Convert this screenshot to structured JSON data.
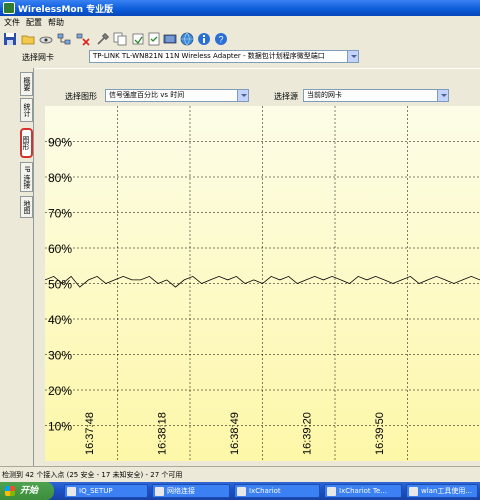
{
  "window": {
    "title": "WirelessMon 专业版"
  },
  "menu": [
    "文件",
    "配置",
    "帮助"
  ],
  "toolbar_icons": [
    "save-icon",
    "open-folder-icon",
    "view-icon",
    "network-icon",
    "disconnect-icon",
    "tools-icon",
    "copy-icon",
    "export-icon",
    "clipboard-check-icon",
    "adapter-icon",
    "globe-icon",
    "info-icon",
    "help-icon"
  ],
  "adapter": {
    "label": "选择网卡",
    "value": "TP-LINK TL-WN821N 11N Wireless Adapter - 数据包计划程序微型端口"
  },
  "tabs": [
    "概要",
    "统计",
    "图形",
    "IP 连接",
    "地图"
  ],
  "active_tab": "图形",
  "graph_controls": {
    "select_graph_label": "选择图形",
    "select_graph_value": "信号强度百分比 vs 时间",
    "select_source_label": "选择源",
    "select_source_value": "当前的网卡"
  },
  "chart_data": {
    "type": "line",
    "title": "",
    "xlabel": "",
    "ylabel": "",
    "ylim": [
      0,
      100
    ],
    "y_ticks": [
      "10%",
      "20%",
      "30%",
      "40%",
      "50%",
      "60%",
      "70%",
      "80%",
      "90%"
    ],
    "x_ticks": [
      "16:37:48",
      "16:38:18",
      "16:38:49",
      "16:39:20",
      "16:39:50"
    ],
    "series": [
      {
        "values": [
          51,
          52,
          50,
          52,
          49,
          51,
          52,
          50,
          51,
          52,
          51,
          51,
          52,
          50,
          51,
          49,
          51,
          52,
          50,
          51,
          52,
          51,
          52,
          50,
          51,
          50,
          52,
          51,
          52,
          50,
          51,
          52,
          51,
          52,
          51,
          50,
          52,
          51,
          52,
          51,
          50,
          51,
          52,
          50,
          51,
          52,
          51,
          50,
          51,
          52,
          51
        ]
      }
    ],
    "grid": true,
    "colors": {
      "background_top": "#fdfde8",
      "background_bottom": "#fdf7a8",
      "line": "#000000"
    }
  },
  "status": {
    "text": "检测到 42 个接入点 (25 安全 - 17 未知安全) - 27 个可用"
  },
  "taskbar": {
    "start_label": "开始",
    "tasks": [
      "IQ_SETUP",
      "网络连接",
      "IxChariot",
      "IxChariot Te...",
      "wlan工具使用..."
    ]
  }
}
